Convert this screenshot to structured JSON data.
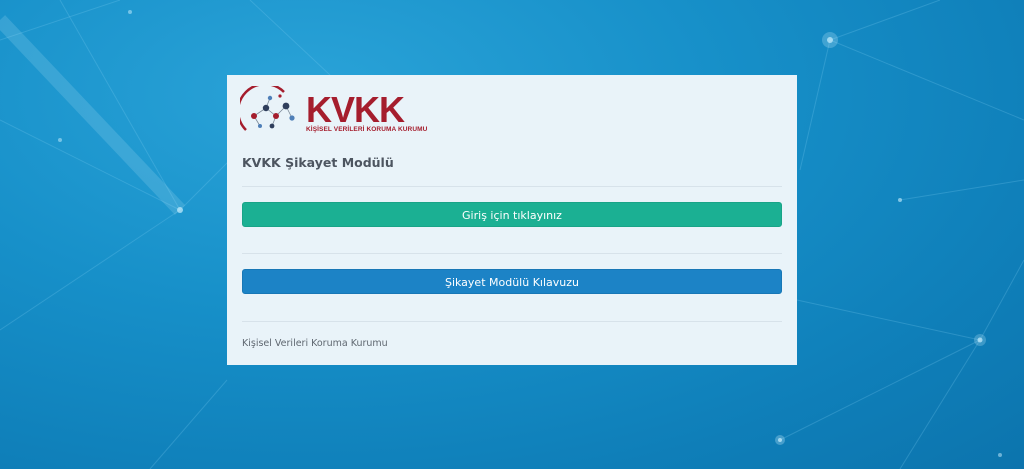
{
  "logo": {
    "word": "KVKK",
    "subtitle": "KİŞİSEL VERİLERİ KORUMA KURUMU",
    "brand_color": "#a51d2d"
  },
  "panel": {
    "title": "KVKK Şikayet Modülü",
    "login_button": "Giriş için tıklayınız",
    "guide_button": "Şikayet Modülü Kılavuzu",
    "footer": "Kişisel Verileri Koruma Kurumu"
  },
  "colors": {
    "login_button": "#1bb093",
    "guide_button": "#1c83c6",
    "panel_background": "#e9f3f9",
    "page_background": "#1a8fc9"
  }
}
